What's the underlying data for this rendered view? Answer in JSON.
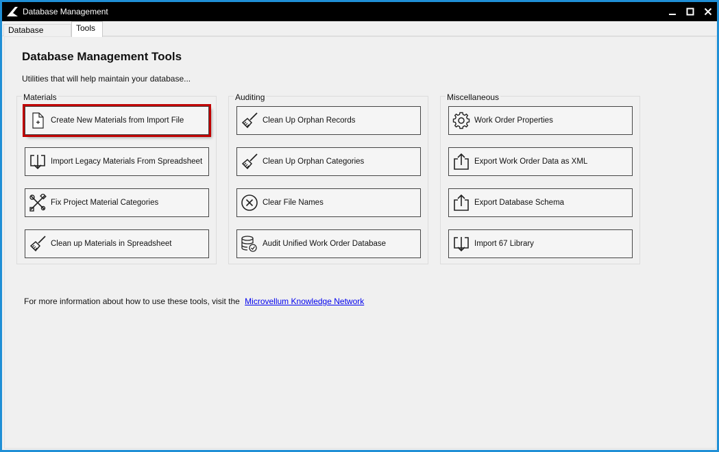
{
  "window": {
    "title": "Database Management",
    "controls": {
      "minimize": "minimize",
      "maximize": "maximize",
      "close": "close"
    }
  },
  "tabs": [
    {
      "label": "Database Records"
    },
    {
      "label": "Tools",
      "active": true
    }
  ],
  "page": {
    "title": "Database Management Tools",
    "subtitle": "Utilities that will help maintain your database..."
  },
  "groups": {
    "materials": {
      "title": "Materials",
      "buttons": [
        {
          "label": "Create New Materials from Import File",
          "icon": "new-document-icon",
          "highlighted": true
        },
        {
          "label": "Import Legacy Materials From Spreadsheet",
          "icon": "import-icon"
        },
        {
          "label": "Fix Project Material Categories",
          "icon": "tools-icon"
        },
        {
          "label": "Clean up Materials in Spreadsheet",
          "icon": "broom-icon"
        }
      ]
    },
    "auditing": {
      "title": "Auditing",
      "buttons": [
        {
          "label": "Clean Up Orphan Records",
          "icon": "broom-icon"
        },
        {
          "label": "Clean Up Orphan Categories",
          "icon": "broom-icon"
        },
        {
          "label": "Clear File Names",
          "icon": "clear-circle-icon"
        },
        {
          "label": "Audit Unified Work Order Database",
          "icon": "database-check-icon"
        }
      ]
    },
    "misc": {
      "title": "Miscellaneous",
      "buttons": [
        {
          "label": "Work Order Properties",
          "icon": "gear-icon"
        },
        {
          "label": "Export Work Order Data as XML",
          "icon": "export-icon"
        },
        {
          "label": "Export Database Schema",
          "icon": "export-icon"
        },
        {
          "label": "Import 67 Library",
          "icon": "import-icon"
        }
      ]
    }
  },
  "footer": {
    "text": "For more information about how to use these tools, visit the",
    "link_label": "Microvellum Knowledge Network"
  },
  "colors": {
    "frame_border": "#1f8fd6",
    "titlebar": "#000000",
    "highlight": "#c00000",
    "link": "#0000ee"
  }
}
